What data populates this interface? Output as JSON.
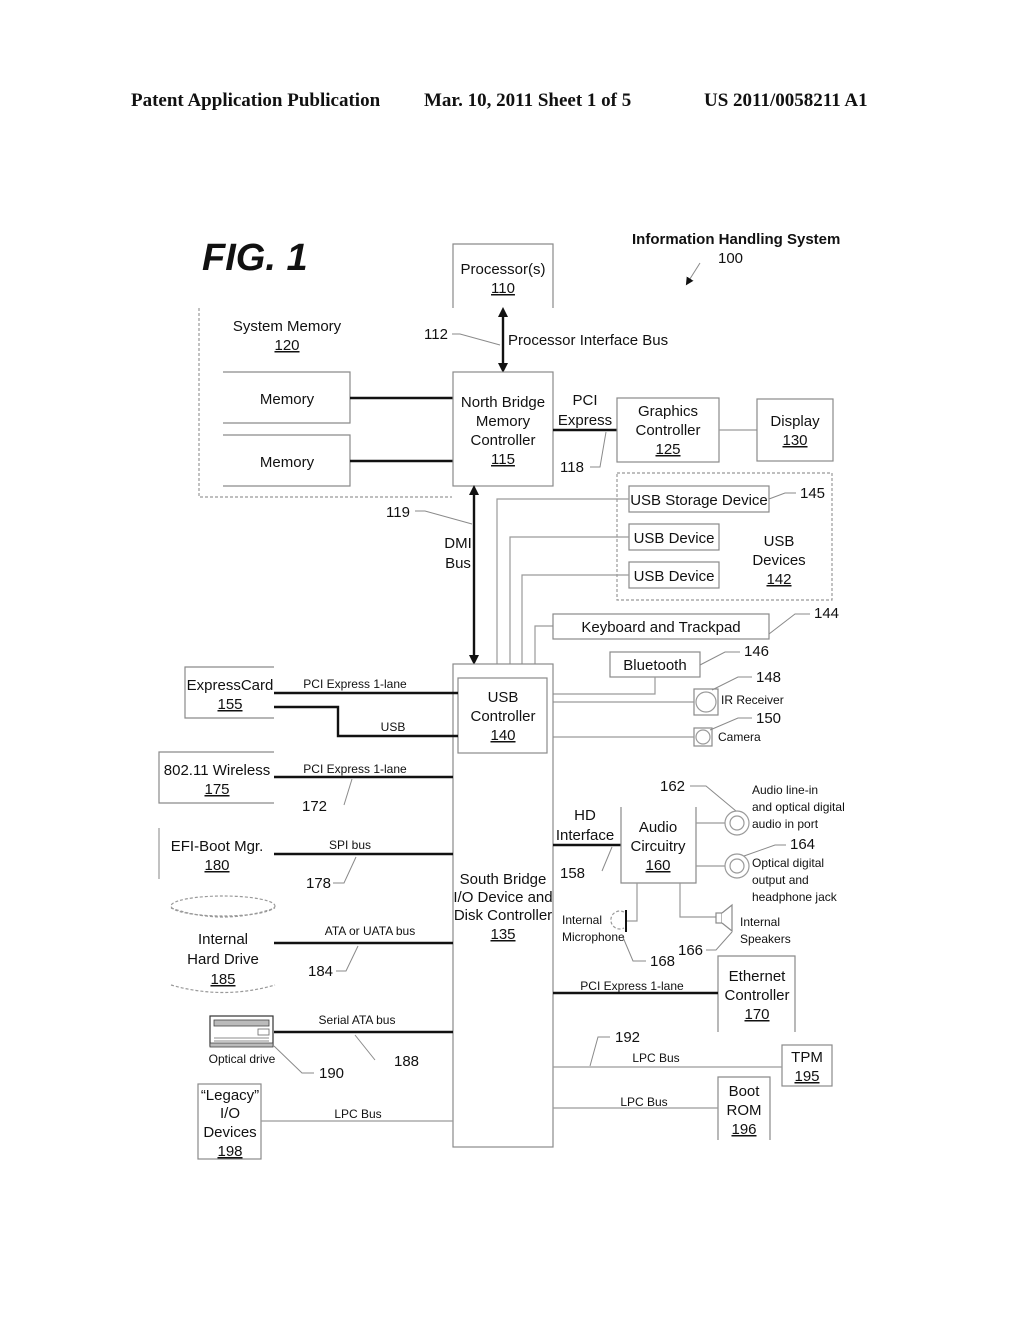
{
  "header": {
    "publication": "Patent Application Publication",
    "date_sheet": "Mar. 10, 2011  Sheet 1 of 5",
    "number": "US 2011/0058211 A1"
  },
  "figure": {
    "title": "FIG. 1",
    "system_title": "Information Handling System",
    "system_ref": "100"
  },
  "components": {
    "processor": {
      "label": "Processor(s)",
      "ref": "110"
    },
    "system_memory": {
      "label": "System Memory",
      "ref": "120"
    },
    "memory1": {
      "label": "Memory"
    },
    "memory2": {
      "label": "Memory"
    },
    "north_bridge": {
      "lines": [
        "North Bridge",
        "Memory",
        "Controller"
      ],
      "ref": "115"
    },
    "graphics": {
      "lines": [
        "Graphics",
        "Controller"
      ],
      "ref": "125"
    },
    "display": {
      "label": "Display",
      "ref": "130"
    },
    "usb_storage": {
      "label": "USB Storage Device"
    },
    "usb_device1": {
      "label": "USB Device"
    },
    "usb_device2": {
      "label": "USB Device"
    },
    "usb_devices_group": {
      "lines": [
        "USB",
        "Devices"
      ],
      "ref": "142"
    },
    "keyboard": {
      "label": "Keyboard and Trackpad"
    },
    "bluetooth": {
      "label": "Bluetooth"
    },
    "ir_receiver": {
      "label": "IR Receiver"
    },
    "camera": {
      "label": "Camera"
    },
    "usb_controller": {
      "lines": [
        "USB",
        "Controller"
      ],
      "ref": "140"
    },
    "south_bridge": {
      "lines": [
        "South Bridge",
        "I/O Device and",
        "Disk Controller"
      ],
      "ref": "135"
    },
    "expresscard": {
      "label": "ExpressCard",
      "ref": "155"
    },
    "wireless": {
      "label": "802.11 Wireless",
      "ref": "175"
    },
    "efi": {
      "label": "EFI-Boot Mgr.",
      "ref": "180"
    },
    "hard_drive": {
      "lines": [
        "Internal",
        "Hard Drive"
      ],
      "ref": "185"
    },
    "optical": {
      "label": "Optical drive"
    },
    "legacy": {
      "lines": [
        "“Legacy”",
        "I/O",
        "Devices"
      ],
      "ref": "198"
    },
    "audio": {
      "lines": [
        "Audio",
        "Circuitry"
      ],
      "ref": "160"
    },
    "audio_in": {
      "lines": [
        "Audio line-in",
        "and optical digital",
        "audio in port"
      ]
    },
    "audio_out": {
      "lines": [
        "Optical digital",
        "output and",
        "headphone jack"
      ]
    },
    "microphone": {
      "lines": [
        "Internal",
        "Microphone"
      ]
    },
    "speakers": {
      "lines": [
        "Internal",
        "Speakers"
      ]
    },
    "ethernet": {
      "lines": [
        "Ethernet",
        "Controller"
      ],
      "ref": "170"
    },
    "tpm": {
      "label": "TPM",
      "ref": "195"
    },
    "boot_rom": {
      "lines": [
        "Boot",
        "ROM"
      ],
      "ref": "196"
    }
  },
  "buses": {
    "processor_bus": "Processor Interface Bus",
    "pci_express": [
      "PCI",
      "Express"
    ],
    "dmi": [
      "DMI",
      "Bus"
    ],
    "pcie_expresscard": "PCI Express 1-lane",
    "usb_expresscard": "USB",
    "pcie_wireless": "PCI Express 1-lane",
    "spi": "SPI bus",
    "ata": "ATA or UATA bus",
    "sata": "Serial ATA bus",
    "lpc_legacy": "LPC Bus",
    "hd_interface": [
      "HD",
      "Interface"
    ],
    "pcie_ethernet": "PCI Express 1-lane",
    "lpc_tpm": "LPC Bus",
    "lpc_bootrom": "LPC Bus"
  },
  "refs": {
    "r112": "112",
    "r118": "118",
    "r119": "119",
    "r144": "144",
    "r145": "145",
    "r146": "146",
    "r148": "148",
    "r150": "150",
    "r158": "158",
    "r162": "162",
    "r164": "164",
    "r166": "166",
    "r168": "168",
    "r172": "172",
    "r178": "178",
    "r184": "184",
    "r188": "188",
    "r190": "190",
    "r192": "192"
  }
}
